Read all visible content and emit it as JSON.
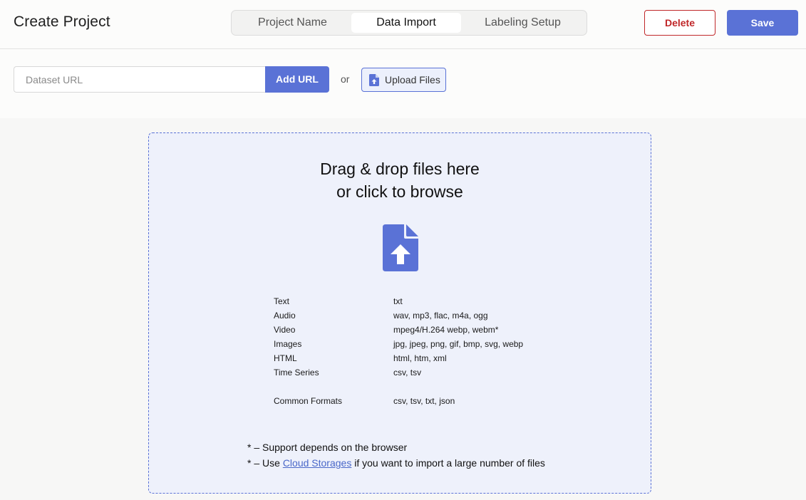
{
  "header": {
    "title": "Create Project",
    "tabs": [
      {
        "label": "Project Name",
        "active": false
      },
      {
        "label": "Data Import",
        "active": true
      },
      {
        "label": "Labeling Setup",
        "active": false
      }
    ],
    "delete_label": "Delete",
    "save_label": "Save"
  },
  "import_bar": {
    "url_placeholder": "Dataset URL",
    "url_value": "",
    "add_url_label": "Add URL",
    "or_label": "or",
    "upload_label": "Upload Files",
    "upload_icon": "file-upload-icon"
  },
  "dropzone": {
    "title_line1": "Drag & drop files here",
    "title_line2": "or click to browse",
    "icon": "file-upload-icon",
    "formats": [
      {
        "type": "Text",
        "ext": "txt"
      },
      {
        "type": "Audio",
        "ext": "wav, mp3, flac, m4a, ogg"
      },
      {
        "type": "Video",
        "ext": "mpeg4/H.264 webp, webm*"
      },
      {
        "type": "Images",
        "ext": "jpg, jpeg, png, gif, bmp, svg, webp"
      },
      {
        "type": "HTML",
        "ext": "html, htm, xml"
      },
      {
        "type": "Time Series",
        "ext": "csv, tsv"
      },
      {
        "type": "Common Formats",
        "ext": "csv, tsv, txt, json"
      }
    ],
    "note1": "* – Support depends on the browser",
    "note2_prefix": "* – Use ",
    "note2_link": "Cloud Storages",
    "note2_suffix": " if you want to import a large number of files"
  },
  "colors": {
    "accent": "#5a72d6",
    "danger": "#c0282a",
    "dropzone_bg": "#eef1fb"
  }
}
